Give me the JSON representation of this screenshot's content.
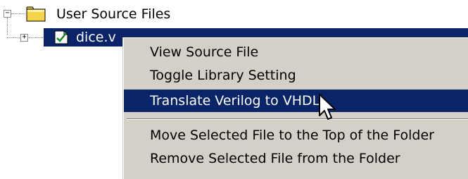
{
  "tree": {
    "root": {
      "label": "User Source Files",
      "icon": "folder-icon",
      "expander": "−"
    },
    "child": {
      "label": "dice.v",
      "icon": "verilog-file-icon",
      "expander": "+"
    }
  },
  "context_menu": {
    "items": [
      {
        "label": "View Source File"
      },
      {
        "label": "Toggle Library Setting"
      },
      {
        "label": "Translate Verilog to VHDL",
        "highlighted": true
      },
      {
        "label": "Move Selected File to the Top of the Folder"
      },
      {
        "label": "Remove Selected File from the Folder"
      }
    ]
  },
  "colors": {
    "selection": "#0a246a",
    "menu_background": "#d4d0c8",
    "folder_yellow": "#f5d44a"
  }
}
